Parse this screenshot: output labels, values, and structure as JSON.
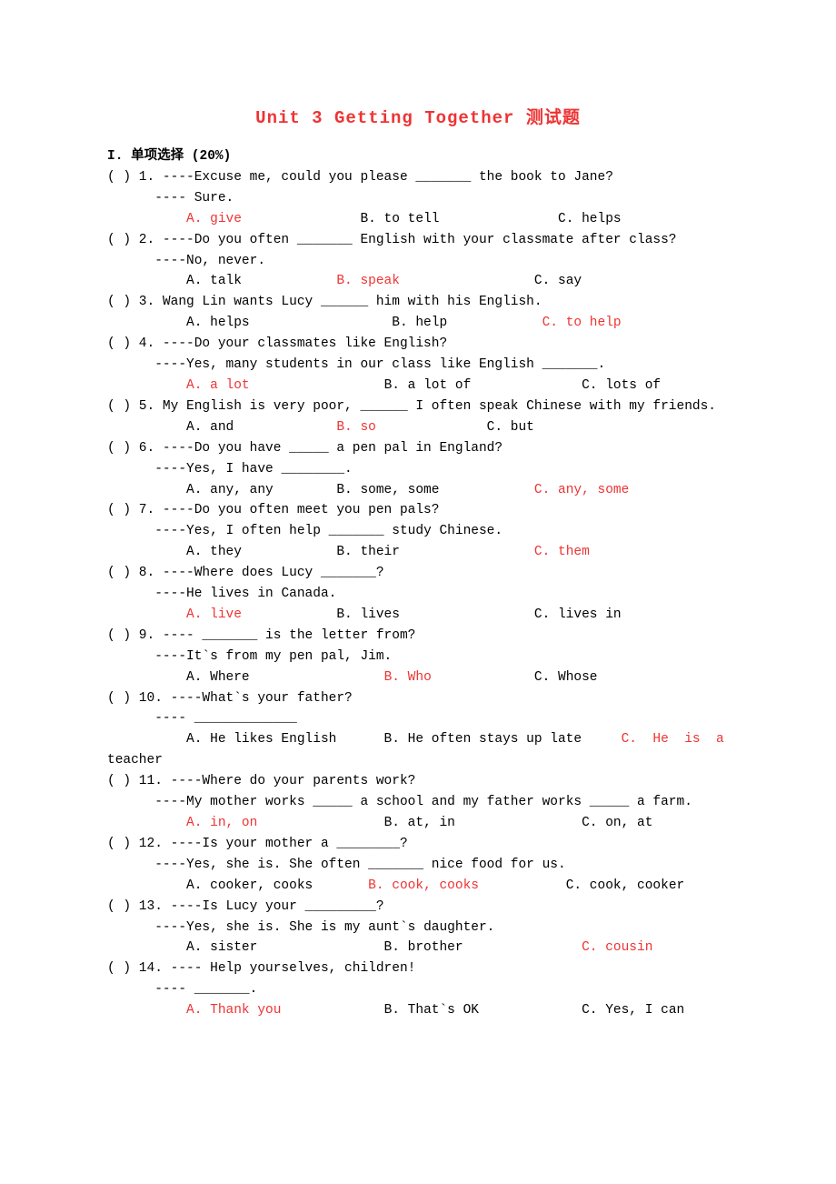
{
  "title": "Unit 3 Getting Together 测试题",
  "sectionHeader": "I. 单项选择 (20%)",
  "q": [
    {
      "n": "1",
      "stem": "----Excuse me, could you please _______ the book to Jane?",
      "stem2": "---- Sure.",
      "a": "A. give",
      "b": "B. to tell",
      "c": "C. helps",
      "ans": "A"
    },
    {
      "n": "2",
      "stem": "----Do you often _______ English with your classmate after class?",
      "stem2": "----No, never.",
      "a": "A. talk",
      "b": "B. speak",
      "c": "C. say",
      "ans": "B"
    },
    {
      "n": "3",
      "stem": "Wang Lin wants Lucy ______ him with his English.",
      "a": "A. helps",
      "b": "B. help",
      "c": "C. to help",
      "ans": "C"
    },
    {
      "n": "4",
      "stem": "----Do your classmates like English?",
      "stem2": "----Yes, many students in our class like English _______.",
      "a": "A. a lot",
      "b": "B. a lot of",
      "c": "C. lots of",
      "ans": "A"
    },
    {
      "n": "5",
      "stem": "My English is very poor, ______ I often speak Chinese with my friends.",
      "a": "A. and",
      "b": "B. so",
      "c": "C. but",
      "ans": "B"
    },
    {
      "n": "6",
      "stem": "----Do you have _____ a pen pal in England?",
      "stem2": "----Yes, I have ________.",
      "a": "A. any, any",
      "b": "B. some, some",
      "c": "C. any, some",
      "ans": "C"
    },
    {
      "n": "7",
      "stem": "----Do you often meet you pen pals?",
      "stem2": "----Yes, I often help _______ study Chinese.",
      "a": "A. they",
      "b": "B. their",
      "c": "C. them",
      "ans": "C"
    },
    {
      "n": "8",
      "stem": "----Where does Lucy _______?",
      "stem2": "----He lives in Canada.",
      "a": "A. live",
      "b": "B. lives",
      "c": "C. lives in",
      "ans": "A"
    },
    {
      "n": "9",
      "stem": "---- _______ is the letter from?",
      "stem2": "----It`s from my pen pal, Jim.",
      "a": "A. Where",
      "b": "B. Who",
      "c": "C. Whose",
      "ans": "B"
    },
    {
      "n": "10",
      "stem": "----What`s your father?",
      "stem2": "---- _____________",
      "a": "A. He likes English",
      "b": "B. He often stays up late",
      "c": "C.  He  is  a",
      "c2": "teacher",
      "ans": "C"
    },
    {
      "n": "11",
      "stem": "----Where do your parents work?",
      "stem2": "----My mother works _____ a school and my father works _____ a farm.",
      "a": "A. in, on",
      "b": "B. at, in",
      "c": "C. on, at",
      "ans": "A"
    },
    {
      "n": "12",
      "stem": "----Is your mother a ________?",
      "stem2": "----Yes, she is. She often _______ nice food for us.",
      "a": "A. cooker, cooks",
      "b": "B. cook, cooks",
      "c": "C. cook, cooker",
      "ans": "B"
    },
    {
      "n": "13",
      "stem": "----Is Lucy your _________?",
      "stem2": "----Yes, she is. She is my aunt`s daughter.",
      "a": "A. sister",
      "b": "B. brother",
      "c": "C. cousin",
      "ans": "C"
    },
    {
      "n": "14",
      "stem": "---- Help yourselves, children!",
      "stem2": "---- _______.",
      "a": "A. Thank you",
      "b": "B. That`s OK",
      "c": "C. Yes, I can",
      "ans": "A"
    }
  ]
}
